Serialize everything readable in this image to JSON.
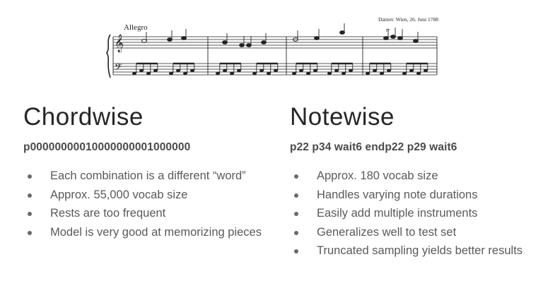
{
  "score": {
    "tempo_marking": "Allegro",
    "date_note": "Datiert: Wien, 26. Juni 1788",
    "ornament": "tr"
  },
  "left": {
    "title": "Chordwise",
    "encoding": "p00000000010000000001000000",
    "bullets": [
      "Each combination is a different “word”",
      "Approx. 55,000 vocab size",
      "Rests are too frequent",
      "Model is very good at memorizing pieces"
    ]
  },
  "right": {
    "title": "Notewise",
    "encoding": "p22 p34 wait6 endp22 p29 wait6",
    "bullets": [
      "Approx. 180 vocab size",
      "Handles varying note durations",
      "Easily add multiple instruments",
      "Generalizes well to test set",
      "Truncated sampling yields better results"
    ]
  }
}
